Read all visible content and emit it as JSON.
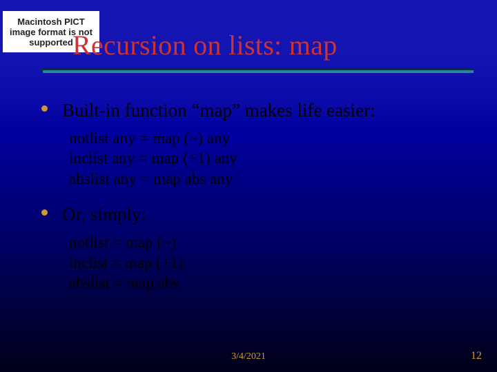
{
  "pict_box": "Macintosh PICT image format is not supported",
  "title": "Recursion on lists: map",
  "bullets": {
    "b1": "Built-in function “map” makes life easier:",
    "b2": "Or, simply:"
  },
  "code1": {
    "l1": "notlist any = map (~) any",
    "l2": "inclist any = map (+1) any",
    "l3": "abslist any = map abs any"
  },
  "code2": {
    "l1": "notlist = map (~)",
    "l2": "inclist = map (+1)",
    "l3": "abslist = map abs"
  },
  "footer": {
    "date": "3/4/2021",
    "page": "12"
  }
}
